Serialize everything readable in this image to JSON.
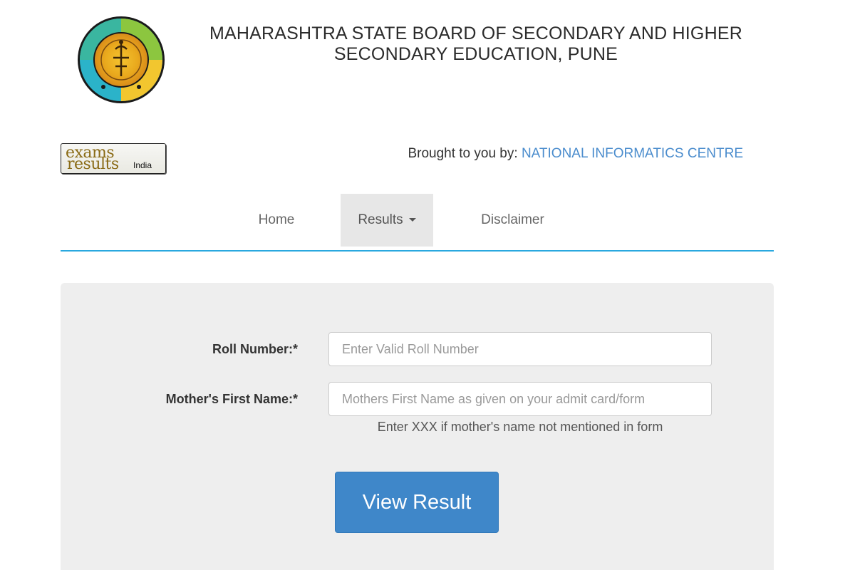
{
  "header": {
    "board_title_line1": "MAHARASHTRA STATE BOARD OF SECONDARY AND HIGHER",
    "board_title_line2": "SECONDARY EDUCATION, PUNE",
    "logo_icon": "maharashtra-board-emblem-icon"
  },
  "branding": {
    "partner_logo_word1": "exams",
    "partner_logo_word2": "results",
    "partner_logo_word3": "India",
    "brought_prefix": "Brought to you by:",
    "brought_org": "NATIONAL INFORMATICS CENTRE"
  },
  "nav": {
    "home": "Home",
    "results": "Results",
    "disclaimer": "Disclaimer"
  },
  "form": {
    "roll_label": "Roll Number:*",
    "roll_placeholder": "Enter Valid Roll Number",
    "mother_label": "Mother's First Name:*",
    "mother_placeholder": "Mothers First Name as given on your admit card/form",
    "mother_hint": "Enter XXX if mother's name not mentioned in form",
    "submit_label": "View Result"
  },
  "colors": {
    "accent_link": "#4a8ccd",
    "nav_underline": "#29a8df",
    "button": "#3f87c9",
    "panel_bg": "#eeeeee"
  }
}
